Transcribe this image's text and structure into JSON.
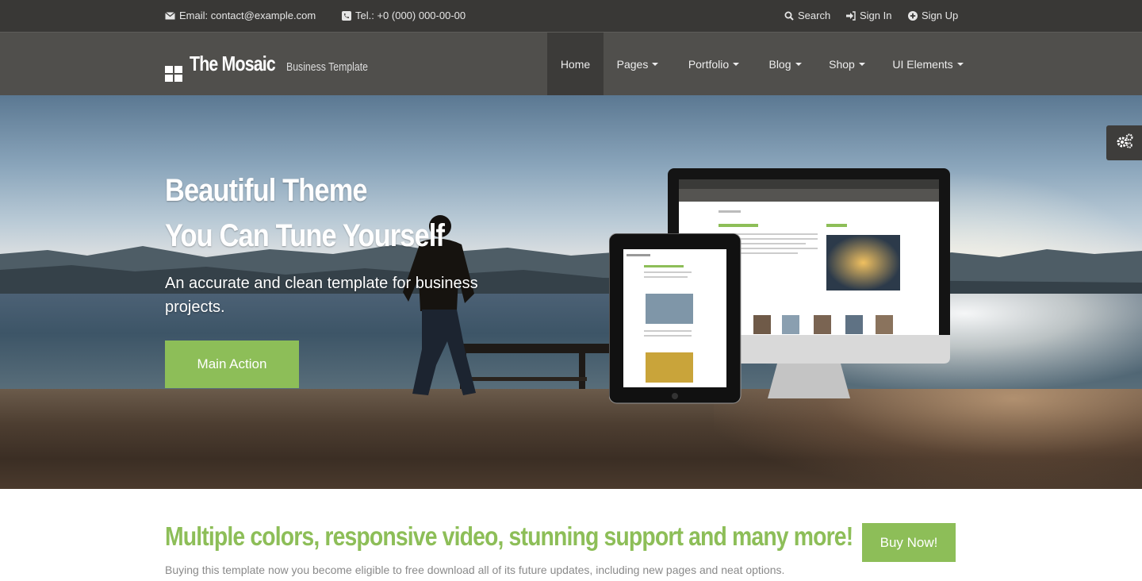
{
  "topbar": {
    "email": "Email: contact@example.com",
    "phone": "Tel.: +0 (000) 000-00-00",
    "search": "Search",
    "sign_in": "Sign In",
    "sign_up": "Sign Up"
  },
  "brand": {
    "name": "The Mosaic",
    "tagline": "Business Template"
  },
  "nav": [
    {
      "label": "Home",
      "active": true,
      "dropdown": false
    },
    {
      "label": "Pages",
      "dropdown": true
    },
    {
      "label": "Portfolio",
      "dropdown": true
    },
    {
      "label": "Blog",
      "dropdown": true
    },
    {
      "label": "Shop",
      "dropdown": true
    },
    {
      "label": "UI Elements",
      "dropdown": true
    }
  ],
  "hero": {
    "title_line1": "Beautiful Theme",
    "title_line2": "You Can Tune Yourself",
    "subtitle": "An accurate and clean template for business projects.",
    "cta": "Main Action"
  },
  "mockup": {
    "section_heading": "About Us",
    "welcome": "Welcome Message",
    "video": "Video Intro"
  },
  "promo": {
    "title": "Multiple colors, responsive video, stunning support and many more!",
    "text": "Buying this template now you become eligible to free download all of its future updates, including new pages and neat options.",
    "buy": "Buy Now!"
  },
  "colors": {
    "accent": "#8dbe58",
    "topbar": "#393836",
    "header": "#504f4c",
    "nav_active": "#3c3b39"
  },
  "icons": {
    "email": "envelope-icon",
    "phone": "phone-icon",
    "search": "search-icon",
    "sign_in": "sign-in-icon",
    "sign_up": "plus-circle-icon",
    "settings": "gears-icon",
    "logo": "grid-logo-icon"
  }
}
